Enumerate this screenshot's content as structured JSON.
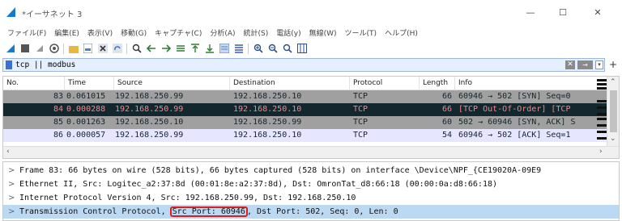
{
  "window": {
    "title": "*イーサネット 3",
    "minimize": "—",
    "maximize": "☐",
    "close": "✕"
  },
  "menu": [
    "ファイル(F)",
    "編集(E)",
    "表示(V)",
    "移動(G)",
    "キャプチャ(C)",
    "分析(A)",
    "統計(S)",
    "電話(y)",
    "無線(W)",
    "ツール(T)",
    "ヘルプ(H)"
  ],
  "filter": {
    "value": "tcp || modbus",
    "clear": "✕",
    "apply": "→",
    "dropdown": "▾",
    "add": "+"
  },
  "packet_list": {
    "columns": [
      "No.",
      "Time",
      "Source",
      "Destination",
      "Protocol",
      "Length",
      "Info"
    ],
    "rows": [
      {
        "no": "83",
        "time": "0.061015",
        "source": "192.168.250.99",
        "destination": "192.168.250.10",
        "protocol": "TCP",
        "length": "66",
        "info": "60946 → 502 [SYN] Seq=0",
        "bg": "#a0a0a0",
        "fg": "#12272e"
      },
      {
        "no": "84",
        "time": "0.000288",
        "source": "192.168.250.99",
        "destination": "192.168.250.10",
        "protocol": "TCP",
        "length": "66",
        "info": "[TCP Out-Of-Order] [TCP",
        "bg": "#12272e",
        "fg": "#f78787"
      },
      {
        "no": "85",
        "time": "0.001263",
        "source": "192.168.250.10",
        "destination": "192.168.250.99",
        "protocol": "TCP",
        "length": "60",
        "info": "502 → 60946 [SYN, ACK] S",
        "bg": "#a0a0a0",
        "fg": "#12272e"
      },
      {
        "no": "86",
        "time": "0.000057",
        "source": "192.168.250.99",
        "destination": "192.168.250.10",
        "protocol": "TCP",
        "length": "54",
        "info": "60946 → 502 [ACK] Seq=1",
        "bg": "#e7e6ff",
        "fg": "#12272e"
      }
    ]
  },
  "details": [
    {
      "caret": ">",
      "text": "Frame 83: 66 bytes on wire (528 bits), 66 bytes captured (528 bits) on interface \\Device\\NPF_{CE19020A-09E9"
    },
    {
      "caret": ">",
      "text": "Ethernet II, Src: Logitec_a2:37:8d (00:01:8e:a2:37:8d), Dst: OmronTat_d8:66:18 (00:00:0a:d8:66:18)"
    },
    {
      "caret": ">",
      "text": "Internet Protocol Version 4, Src: 192.168.250.99, Dst: 192.168.250.10"
    },
    {
      "caret": ">",
      "pre": "Transmission Control Protocol, ",
      "highlight": "Src Port: 60946",
      "post": ", Dst Port: 502, Seq: 0, Len: 0"
    }
  ],
  "colors": {
    "selected_detail": "#bcd9f4",
    "highlight_box": "#e01b1b",
    "filter_bg": "#e4efff"
  }
}
